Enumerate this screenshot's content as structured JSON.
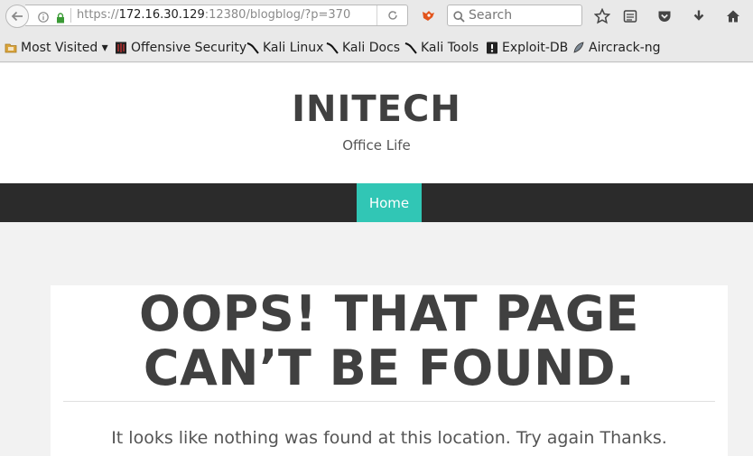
{
  "browser": {
    "url_prefix": "https://",
    "url_host": "172.16.30.129",
    "url_rest": ":12380/blogblog/?p=370",
    "search_placeholder": "Search"
  },
  "bookmarks": [
    {
      "label": "Most Visited ▾",
      "icon": "folder-icon"
    },
    {
      "label": "Offensive Security",
      "icon": "offsec-icon"
    },
    {
      "label": "Kali Linux",
      "icon": "kali-icon"
    },
    {
      "label": "Kali Docs",
      "icon": "kali-icon"
    },
    {
      "label": "Kali Tools",
      "icon": "kali-icon"
    },
    {
      "label": "Exploit-DB",
      "icon": "exploitdb-icon"
    },
    {
      "label": "Aircrack-ng",
      "icon": "aircrack-icon"
    }
  ],
  "site": {
    "title": "INITECH",
    "description": "Office Life",
    "nav_home": "Home"
  },
  "content": {
    "heading": "OOPS! THAT PAGE CAN’T BE FOUND.",
    "message": "It looks like nothing was found at this location. Try again Thanks."
  },
  "colors": {
    "accent": "#31c6b5",
    "nav_bg": "#2b2b2b",
    "title": "#404040"
  }
}
